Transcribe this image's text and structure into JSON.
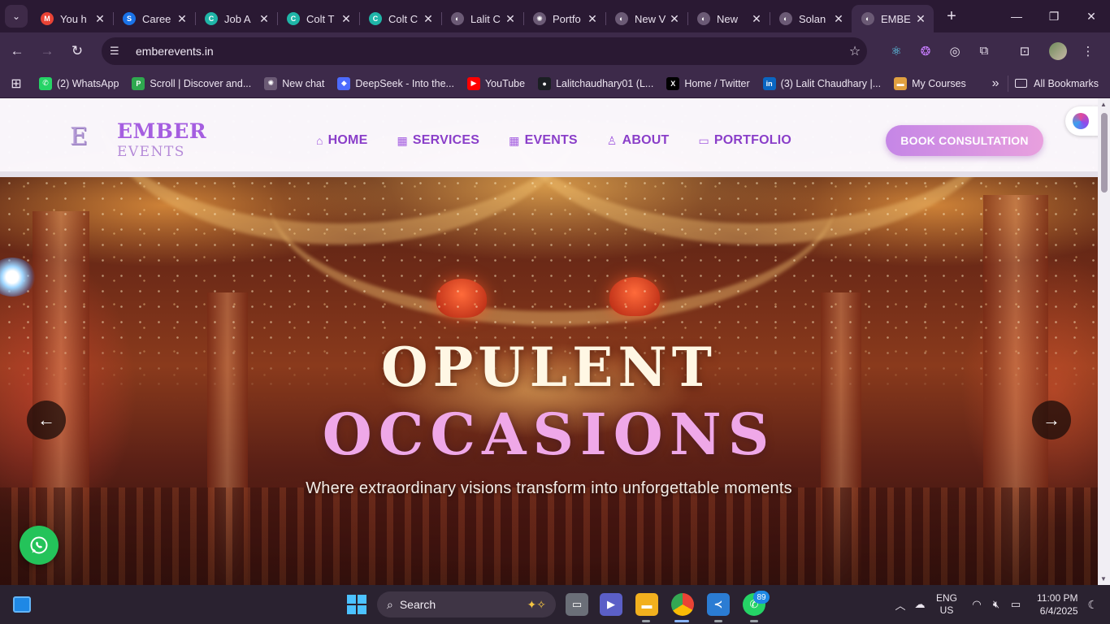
{
  "browser": {
    "tabs": [
      {
        "title": "You h",
        "icon": "gmail-icon",
        "color": "#ea4335",
        "glyph": "M"
      },
      {
        "title": "Caree",
        "icon": "careers-icon",
        "color": "#1a73e8",
        "glyph": "S"
      },
      {
        "title": "Job A",
        "icon": "colt-icon",
        "color": "#1fb5a8",
        "glyph": "C"
      },
      {
        "title": "Colt T",
        "icon": "colt-icon",
        "color": "#1fb5a8",
        "glyph": "C"
      },
      {
        "title": "Colt C",
        "icon": "colt-icon",
        "color": "#1fb5a8",
        "glyph": "C"
      },
      {
        "title": "Lalit C",
        "icon": "globe-icon",
        "color": "#6b5a75",
        "glyph": "◐"
      },
      {
        "title": "Portfo",
        "icon": "openai-icon",
        "color": "#6b5a75",
        "glyph": "✺"
      },
      {
        "title": "New V",
        "icon": "globe-icon",
        "color": "#6b5a75",
        "glyph": "◐"
      },
      {
        "title": "New",
        "icon": "globe-icon",
        "color": "#6b5a75",
        "glyph": "◐"
      },
      {
        "title": "Solan",
        "icon": "globe-icon",
        "color": "#6b5a75",
        "glyph": "◐"
      },
      {
        "title": "EMBE",
        "icon": "globe-icon",
        "color": "#6b5a75",
        "glyph": "◐",
        "active": true
      }
    ],
    "url": "emberevents.in",
    "bookmarks": [
      {
        "label": "(2) WhatsApp",
        "color": "#25d366",
        "glyph": "✆"
      },
      {
        "label": "Scroll | Discover and...",
        "color": "#2fa84f",
        "glyph": "P"
      },
      {
        "label": "New chat",
        "color": "#6b5a75",
        "glyph": "✺"
      },
      {
        "label": "DeepSeek - Into the...",
        "color": "#4d6bfe",
        "glyph": "◆"
      },
      {
        "label": "YouTube",
        "color": "#ff0000",
        "glyph": "▶"
      },
      {
        "label": "Lalitchaudhary01 (L...",
        "color": "#1b1f23",
        "glyph": "●"
      },
      {
        "label": "Home / Twitter",
        "color": "#000000",
        "glyph": "X"
      },
      {
        "label": "(3) Lalit Chaudhary |...",
        "color": "#0a66c2",
        "glyph": "in"
      },
      {
        "label": "My Courses",
        "color": "#e0a040",
        "glyph": "▬"
      }
    ],
    "all_bookmarks": "All Bookmarks"
  },
  "site": {
    "logo_mark": "E",
    "logo_name": "EMBER",
    "logo_sub": "EVENTS",
    "nav": [
      {
        "label": "HOME",
        "icon": "home-icon",
        "glyph": "⌂"
      },
      {
        "label": "SERVICES",
        "icon": "calendar-icon",
        "glyph": "▦"
      },
      {
        "label": "EVENTS",
        "icon": "calendar-icon",
        "glyph": "▦"
      },
      {
        "label": "ABOUT",
        "icon": "user-icon",
        "glyph": "♙"
      },
      {
        "label": "PORTFOLIO",
        "icon": "chat-icon",
        "glyph": "▭"
      }
    ],
    "cta": "BOOK CONSULTATION",
    "hero": {
      "title_line1": "OPULENT",
      "title_line2": "OCCASIONS",
      "subtitle": "Where extraordinary visions transform into unforgettable moments"
    }
  },
  "taskbar": {
    "search": "Search",
    "whatsapp_badge": "89",
    "lang_top": "ENG",
    "lang_bottom": "US",
    "time": "11:00 PM",
    "date": "6/4/2025"
  },
  "colors": {
    "accent": "#a55ee0",
    "cta_start": "#c586e6",
    "cta_end": "#e8a0de",
    "hero_title_2": "#efa8e8"
  }
}
